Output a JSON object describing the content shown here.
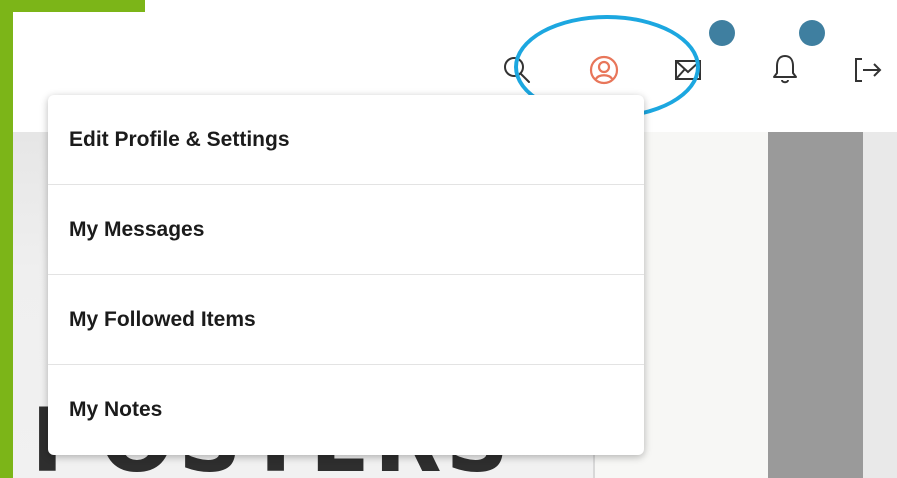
{
  "header": {
    "icons": {
      "search": "search-icon",
      "profile": "user-circle-icon",
      "messages": "mail-icon",
      "notifications": "bell-icon",
      "logout": "logout-icon"
    }
  },
  "profile_menu": {
    "items": [
      {
        "label": "Edit Profile & Settings"
      },
      {
        "label": "My Messages"
      },
      {
        "label": "My Followed Items"
      },
      {
        "label": "My Notes"
      }
    ]
  },
  "hero": {
    "poster_text": "POSTERS"
  },
  "colors": {
    "accent_green": "#7cb518",
    "profile_icon": "#e8765a",
    "highlight": "#1ca7e0",
    "badge": "#3f7fa0"
  }
}
